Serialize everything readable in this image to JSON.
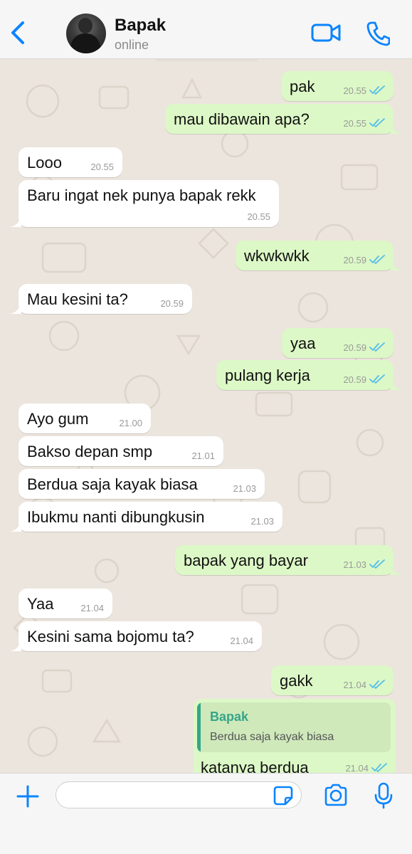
{
  "header": {
    "contact_name": "Bapak",
    "status": "online"
  },
  "messages": [
    {
      "dir": "out",
      "text": "pak",
      "time": "20.55",
      "read": true
    },
    {
      "dir": "out",
      "text": "mau dibawain apa?",
      "time": "20.55",
      "read": true
    },
    {
      "dir": "in",
      "text": "Looo",
      "time": "20.55"
    },
    {
      "dir": "in",
      "text": "Baru ingat nek punya bapak rekk",
      "time": "20.55"
    },
    {
      "dir": "out",
      "text": "wkwkwkk",
      "time": "20.59",
      "read": true
    },
    {
      "dir": "in",
      "text": "Mau kesini ta?",
      "time": "20.59"
    },
    {
      "dir": "out",
      "text": "yaa",
      "time": "20.59",
      "read": true
    },
    {
      "dir": "out",
      "text": "pulang kerja",
      "time": "20.59",
      "read": true
    },
    {
      "dir": "in",
      "text": "Ayo gum",
      "time": "21.00"
    },
    {
      "dir": "in",
      "text": "Bakso depan smp",
      "time": "21.01"
    },
    {
      "dir": "in",
      "text": "Berdua saja kayak biasa",
      "time": "21.03"
    },
    {
      "dir": "in",
      "text": "Ibukmu nanti dibungkusin",
      "time": "21.03"
    },
    {
      "dir": "out",
      "text": "bapak yang bayar",
      "time": "21.03",
      "read": true
    },
    {
      "dir": "in",
      "text": "Yaa",
      "time": "21.04"
    },
    {
      "dir": "in",
      "text": "Kesini sama bojomu ta?",
      "time": "21.04"
    },
    {
      "dir": "out",
      "text": "gakk",
      "time": "21.04",
      "read": true
    }
  ],
  "reply_message": {
    "quote_author": "Bapak",
    "quote_text": "Berdua saja kayak biasa",
    "text": "katanya berdua",
    "time": "21.04",
    "read": true
  },
  "composer": {
    "placeholder": ""
  },
  "colors": {
    "accent_blue": "#0a84ff",
    "outgoing_bubble": "#dcf8c6",
    "incoming_bubble": "#ffffff",
    "read_ticks": "#53bdeb",
    "quote_accent": "#35a588",
    "chat_background": "#ece5dd"
  },
  "icons": {
    "back": "chevron-left-icon",
    "video": "video-camera-icon",
    "call": "phone-icon",
    "attach": "plus-icon",
    "sticker": "sticker-icon",
    "camera": "camera-icon",
    "mic": "microphone-icon",
    "read_receipt": "double-check-icon"
  }
}
